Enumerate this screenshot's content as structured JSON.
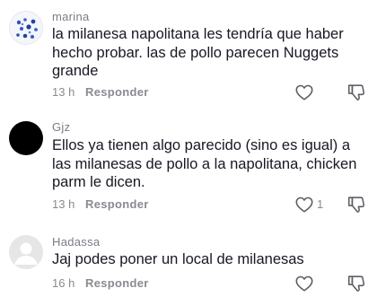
{
  "icons": {
    "like": "heart-outline-icon",
    "dislike": "thumbs-down-outline-icon"
  },
  "comments": [
    {
      "username": "marina",
      "text": "la milanesa napolitana les tendría que haber hecho probar. las de pollo parecen Nuggets grande",
      "time": "13 h",
      "reply": "Responder",
      "likes": ""
    },
    {
      "username": "Gjz",
      "text": "Ellos ya tienen algo parecido (sino es igual) a las milanesas de pollo a la napolitana, chicken parm le dicen.",
      "time": "13 h",
      "reply": "Responder",
      "likes": "1"
    },
    {
      "username": "Hadassa",
      "text": "Jaj podes poner un local de milanesas",
      "time": "16 h",
      "reply": "Responder",
      "likes": ""
    }
  ]
}
